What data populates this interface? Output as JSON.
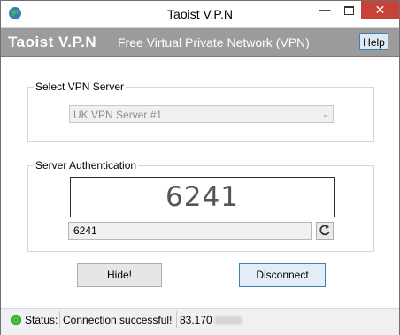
{
  "window": {
    "title": "Taoist V.P.N",
    "minimize_glyph": "—",
    "close_glyph": "✕"
  },
  "header": {
    "brand": "Taoist V.P.N",
    "tagline": "Free Virtual Private Network (VPN)",
    "help_label": "Help"
  },
  "server_group": {
    "label": "Select VPN Server",
    "selected": "UK VPN Server #1",
    "arrow": "⌄"
  },
  "auth_group": {
    "label": "Server Authentication",
    "captcha": "6241",
    "code_value": "6241",
    "refresh_icon": "refresh-icon"
  },
  "buttons": {
    "hide": "Hide!",
    "disconnect": "Disconnect"
  },
  "status": {
    "label": "Status:",
    "message": "Connection successful!",
    "ip_partial": "83.170",
    "indicator_color": "#3cbf3c"
  }
}
